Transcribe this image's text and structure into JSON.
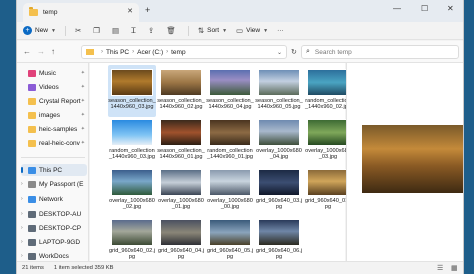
{
  "window": {
    "tab_title": "temp"
  },
  "toolbar": {
    "new_label": "New",
    "sort_label": "Sort",
    "view_label": "View",
    "more_label": "···"
  },
  "address": {
    "segments": [
      "This PC",
      "Acer (C:)",
      "temp"
    ]
  },
  "search": {
    "placeholder": "Search temp"
  },
  "sidebar": {
    "quick": [
      {
        "label": "Music",
        "icon": "music-icon",
        "color": "#e0427a"
      },
      {
        "label": "Videos",
        "icon": "video-folder-icon",
        "color": "#8b5cd6"
      },
      {
        "label": "Crystal Report",
        "icon": "folder-icon",
        "color": "#f4c04e"
      },
      {
        "label": "images",
        "icon": "folder-icon",
        "color": "#f4c04e"
      },
      {
        "label": "heic-samples",
        "icon": "folder-icon",
        "color": "#f4c04e"
      },
      {
        "label": "real-heic-conv",
        "icon": "folder-icon",
        "color": "#f4c04e"
      }
    ],
    "tree": [
      {
        "label": "This PC",
        "icon": "pc-icon",
        "color": "#3a8ee6"
      },
      {
        "label": "My Passport (E",
        "icon": "drive-icon",
        "color": "#8a8a8a"
      },
      {
        "label": "Network",
        "icon": "network-icon",
        "color": "#3a8ee6"
      },
      {
        "label": "DESKTOP-AU",
        "icon": "computer-icon",
        "color": "#5f6b78"
      },
      {
        "label": "DESKTOP-CP",
        "icon": "computer-icon",
        "color": "#5f6b78"
      },
      {
        "label": "LAPTOP-9GD",
        "icon": "computer-icon",
        "color": "#5f6b78"
      },
      {
        "label": "WorkDocs",
        "icon": "workdocs-icon",
        "color": "#5f6b78"
      }
    ]
  },
  "files": [
    {
      "name": "season_collection_1440x960_03.jpg",
      "bg": "linear-gradient(180deg,#6b4a1e 0%,#b07a2c 45%,#5a3a14 100%)"
    },
    {
      "name": "season_collection_1440x960_02.jpg",
      "bg": "linear-gradient(180deg,#c9a77a 0%,#9c7646 50%,#4e3a22 100%)"
    },
    {
      "name": "season_collection_1440x960_04.jpg",
      "bg": "linear-gradient(180deg,#5b6fb0 0%,#9a8ec4 40%,#3c5a3a 100%)"
    },
    {
      "name": "season_collection_1440x960_05.jpg",
      "bg": "linear-gradient(180deg,#6e8fb6 0%,#c2cfe0 45%,#5b6b5a 100%)"
    },
    {
      "name": "random_collection_1440x960_02.jpg",
      "bg": "linear-gradient(180deg,#2d6f9c 0%,#4aa4c2 50%,#1f4a63 100%)"
    },
    {
      "name": "random_collection_1440x960_03.jpg",
      "bg": "linear-gradient(180deg,#2a8ae0 0%,#7fc4f4 60%,#e6eef6 100%)"
    },
    {
      "name": "season_collection_1440x960_01.jpg",
      "bg": "linear-gradient(180deg,#3b2a1c 0%,#a0522d 50%,#2c1e12 100%)"
    },
    {
      "name": "random_collection_1440x960_01.jpg",
      "bg": "linear-gradient(180deg,#4a3420 0%,#8c6a44 50%,#3a2b1a 100%)"
    },
    {
      "name": "overlay_1000x680_04.jpg",
      "bg": "linear-gradient(180deg,#6e8ab0 0%,#a8b8cc 45%,#3e4e3a 100%)"
    },
    {
      "name": "overlay_1000x680_03.jpg",
      "bg": "linear-gradient(180deg,#3d6a34 0%,#7fa85a 50%,#264a22 100%)"
    },
    {
      "name": "overlay_1000x680_02.jpg",
      "bg": "linear-gradient(180deg,#3b5e8c 0%,#79a7c9 45%,#2f5a3a 100%)"
    },
    {
      "name": "overlay_1000x680_01.jpg",
      "bg": "linear-gradient(180deg,#5a6e86 0%,#c6cfd8 50%,#3a4454 100%)"
    },
    {
      "name": "overlay_1000x680_00.jpg",
      "bg": "linear-gradient(180deg,#8a9aae 0%,#c8d4de 45%,#4c5868 100%)"
    },
    {
      "name": "grid_960x640_03.jpg",
      "bg": "linear-gradient(180deg,#1c2a44 0%,#3c4e72 50%,#10182a 100%)"
    },
    {
      "name": "grid_960x640_01.jpg",
      "bg": "linear-gradient(180deg,#8b6a3a 0%,#d0a55a 45%,#5a4020 100%)"
    },
    {
      "name": "grid_960x640_02.jpg",
      "bg": "linear-gradient(180deg,#5a6b8c 0%,#a3a79a 45%,#3c4a34 100%)"
    },
    {
      "name": "grid_960x640_04.jpg",
      "bg": "linear-gradient(180deg,#4a5060 0%,#8a8678 50%,#2f3036 100%)"
    },
    {
      "name": "grid_960x640_05.jpg",
      "bg": "linear-gradient(180deg,#3a5a7a 0%,#8aa4bc 50%,#4a4028 100%)"
    },
    {
      "name": "grid_960x640_06.jpg",
      "bg": "linear-gradient(180deg,#2a3a5a 0%,#6f86a6 45%,#2c2a20 100%)"
    }
  ],
  "selected_index": 0,
  "preview": {
    "bg": "linear-gradient(180deg,#7a5a2a 0%,#c48a3a 35%,#8a5a24 60%,#3e2a12 100%)"
  },
  "status": {
    "count": "21 items",
    "selected": "1 item selected 359 KB"
  }
}
